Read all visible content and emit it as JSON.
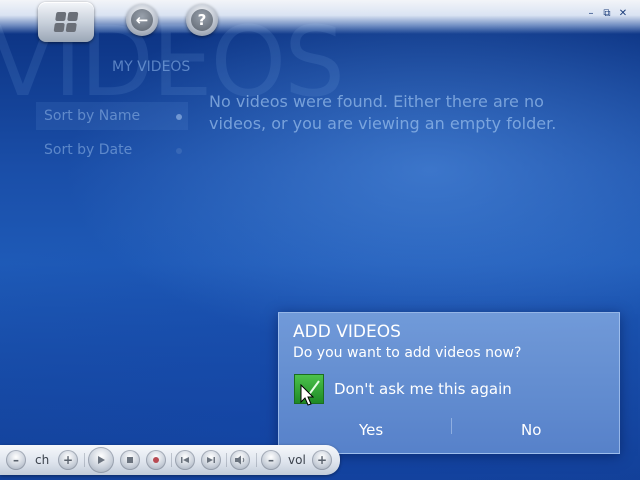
{
  "watermark": "VIDEOS",
  "top_bar": {
    "start_icon": "windows-logo-icon",
    "back_icon": "back-arrow-icon",
    "help_icon": "help-icon",
    "help_glyph": "?",
    "back_glyph": "←",
    "window_controls": [
      "–",
      "⧉",
      "✕"
    ]
  },
  "page": {
    "title": "MY VIDEOS",
    "sort_options": [
      {
        "label": "Sort by Name",
        "selected": true
      },
      {
        "label": "Sort by Date",
        "selected": false
      }
    ],
    "message": "No videos were found. Either there are no videos, or you are viewing an empty folder."
  },
  "dialog": {
    "title": "ADD VIDEOS",
    "question": "Do you want to add videos now?",
    "checkbox_label": "Don't ask me this again",
    "checkbox_checked": true,
    "yes_label": "Yes",
    "no_label": "No"
  },
  "transport": {
    "ch_label": "ch",
    "vol_label": "vol",
    "minus_glyph": "–",
    "plus_glyph": "+"
  },
  "colors": {
    "background": "#1a4ea8",
    "dialog": "#6f96d6",
    "checkbox": "#2a9a2e"
  }
}
